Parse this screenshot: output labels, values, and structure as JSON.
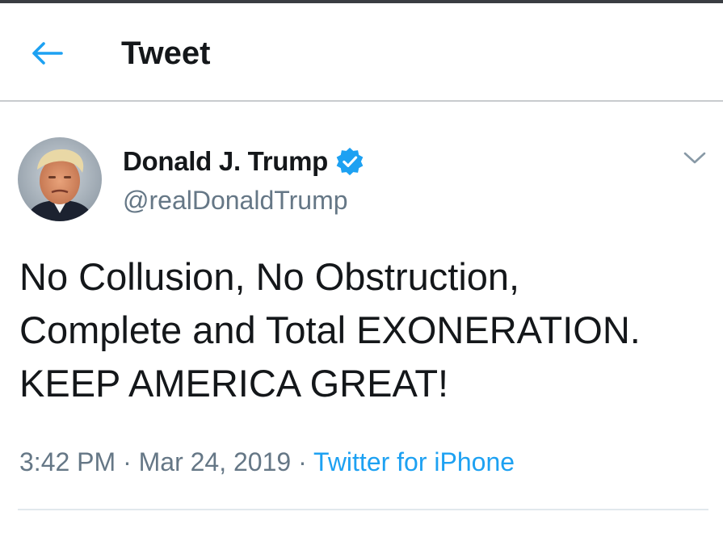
{
  "header": {
    "title": "Tweet"
  },
  "tweet": {
    "author_name": "Donald J. Trump",
    "handle": "@realDonaldTrump",
    "text_lines": [
      "No Collusion, No Obstruction,",
      "Complete and Total EXONERATION.",
      "KEEP AMERICA GREAT!"
    ],
    "time": "3:42 PM",
    "separator": " · ",
    "date": "Mar 24, 2019",
    "source": "Twitter for iPhone"
  },
  "icons": {
    "back": "arrow-left-icon",
    "verified": "verified-badge-icon",
    "more": "chevron-down-icon"
  },
  "colors": {
    "accent": "#1da1f2",
    "text_primary": "#14171a",
    "text_secondary": "#657786",
    "border": "#e1e8ed"
  }
}
